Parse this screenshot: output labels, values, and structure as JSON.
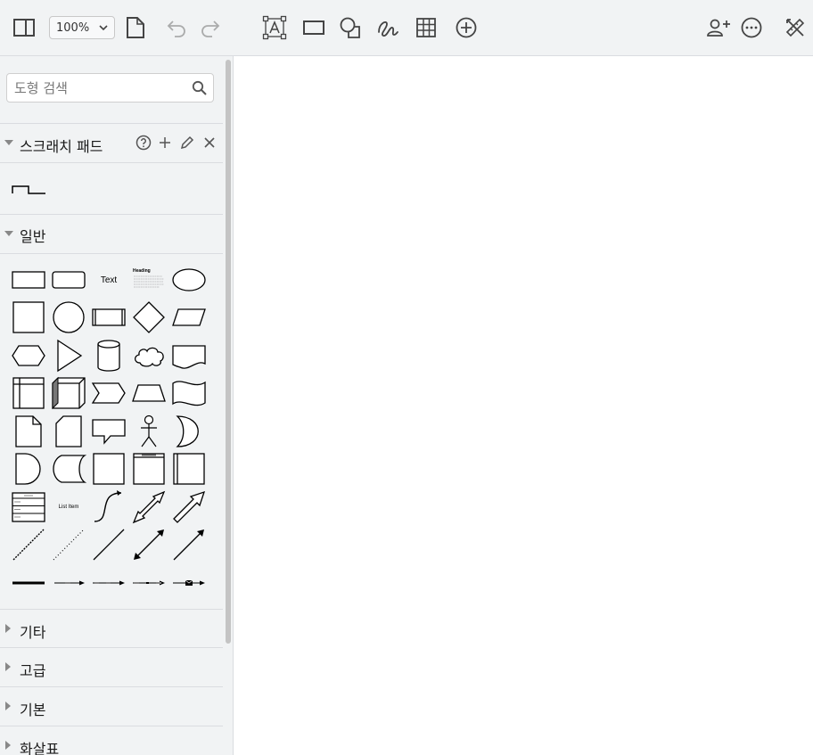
{
  "toolbar": {
    "zoom": "100%",
    "items": [
      "format-panel-toggle",
      "new-page",
      "undo",
      "redo",
      "text",
      "rectangle",
      "shapes",
      "freehand",
      "table",
      "insert",
      "share",
      "more",
      "tools"
    ]
  },
  "sidebar": {
    "search_placeholder": "도형 검색",
    "sections": {
      "scratchpad": "스크래치 패드",
      "general": "일반",
      "misc": "기타",
      "advanced": "고급",
      "basic": "기본",
      "arrows": "화살표"
    },
    "shape_text": {
      "text": "Text",
      "heading": "Heading",
      "list_item": "List Item"
    }
  },
  "colors": {
    "toolbar_bg": "#f1f3f4",
    "sidebar_bg": "#f1f3f4",
    "canvas_bg": "#ffffff",
    "icon_stroke": "#444444",
    "shape_stroke": "#000000"
  }
}
